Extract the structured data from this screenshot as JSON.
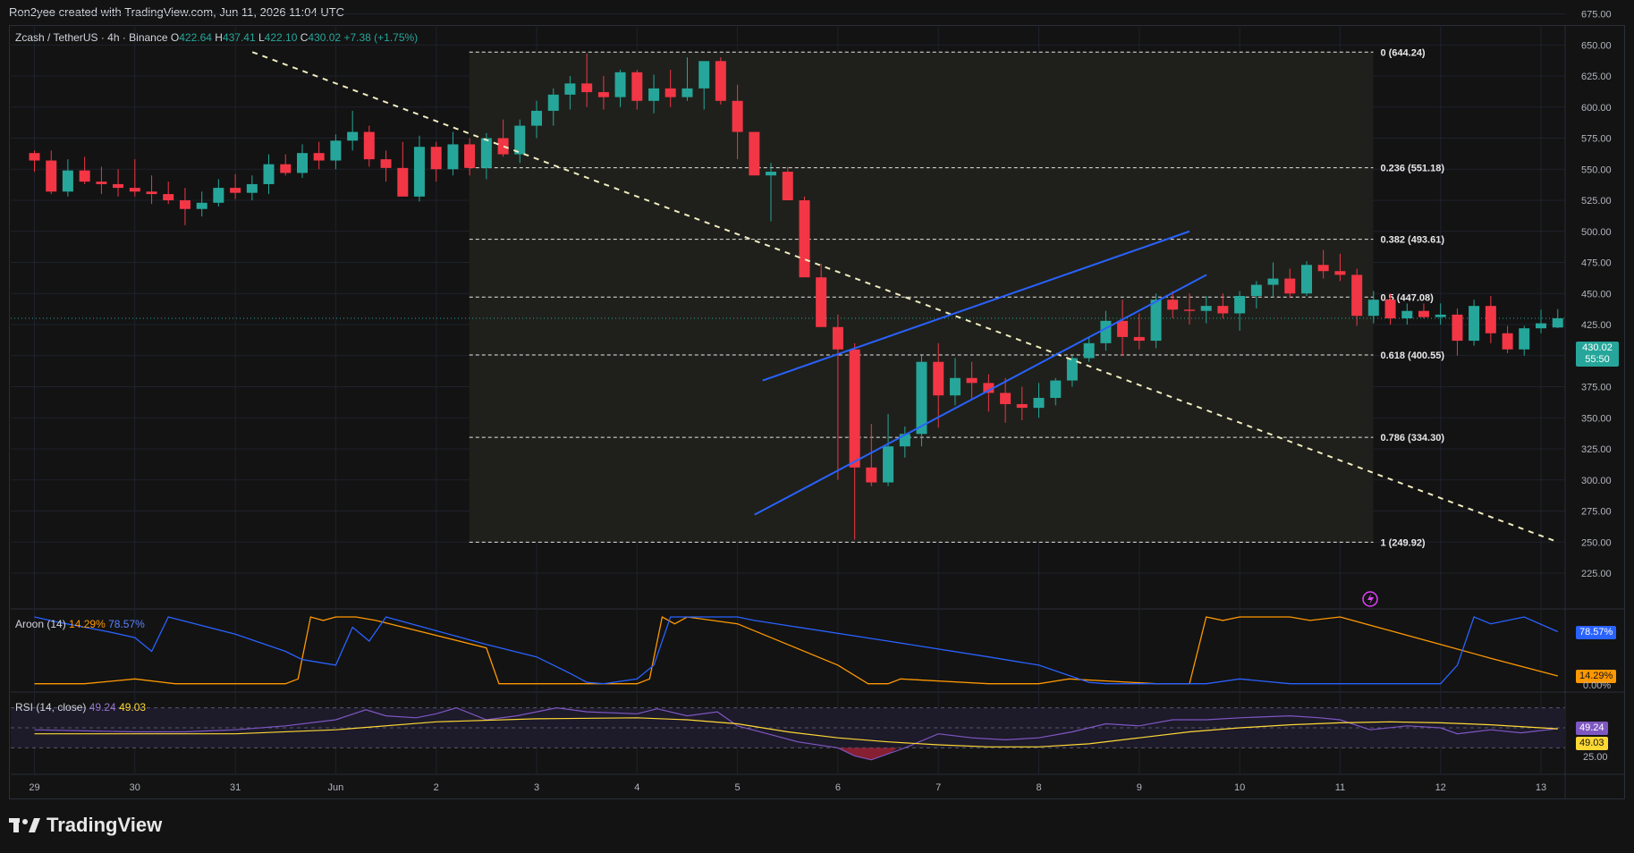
{
  "header": {
    "credit": "Ron2yee created with TradingView.com, Jun 11, 2026 11:04 UTC"
  },
  "symbol": {
    "name": "Zcash / TetherUS · 4h · Binance",
    "open_label": "O",
    "open": "422.64",
    "high_label": "H",
    "high": "437.41",
    "low_label": "L",
    "low": "422.10",
    "close_label": "C",
    "close": "430.02",
    "change": "+7.38 (+1.75%)"
  },
  "price_badge": {
    "price": "430.02",
    "countdown": "55:50"
  },
  "colors": {
    "up": "#26a69a",
    "down": "#f23645",
    "wedge": "#2962ff",
    "fib": "#e8e8e8",
    "aroon_up": "#ff9800",
    "aroon_down": "#2962ff",
    "rsi": "#7e57c2",
    "rsi_ma": "#fdd835"
  },
  "price_axis": {
    "ticks": [
      "225.00",
      "250.00",
      "275.00",
      "300.00",
      "325.00",
      "350.00",
      "375.00",
      "400.00",
      "425.00",
      "450.00",
      "475.00",
      "500.00",
      "525.00",
      "550.00",
      "575.00",
      "600.00",
      "625.00",
      "650.00",
      "675.00"
    ]
  },
  "time_axis": {
    "labels": [
      "29",
      "30",
      "31",
      "Jun",
      "2",
      "3",
      "4",
      "5",
      "6",
      "7",
      "8",
      "9",
      "10",
      "11",
      "12",
      "13"
    ]
  },
  "fib_levels": [
    {
      "label": "0 (644.24)",
      "price": 644.24
    },
    {
      "label": "0.236 (551.18)",
      "price": 551.18
    },
    {
      "label": "0.382 (493.61)",
      "price": 493.61
    },
    {
      "label": "0.5 (447.08)",
      "price": 447.08
    },
    {
      "label": "0.618 (400.55)",
      "price": 400.55
    },
    {
      "label": "0.786 (334.30)",
      "price": 334.3
    },
    {
      "label": "1 (249.92)",
      "price": 249.92
    }
  ],
  "aroon": {
    "title": "Aroon (14)",
    "up_value": "14.29%",
    "down_value": "78.57%",
    "axis_label": "0.00%"
  },
  "rsi": {
    "title": "RSI (14, close)",
    "value": "49.24",
    "ma_value": "49.03",
    "axis_label": "25.00"
  },
  "footer": {
    "brand": "TradingView"
  },
  "chart_data": {
    "type": "candlestick",
    "title": "Zcash / TetherUS · 4h · Binance",
    "x_unit": "days (0 = May 29 00:00 UTC)",
    "ylim": [
      215,
      685
    ],
    "candles": [
      [
        0.0,
        563,
        565,
        548,
        557
      ],
      [
        0.167,
        557,
        565,
        530,
        532
      ],
      [
        0.333,
        532,
        558,
        528,
        549
      ],
      [
        0.5,
        549,
        560,
        538,
        540
      ],
      [
        0.667,
        540,
        552,
        530,
        538
      ],
      [
        0.833,
        538,
        550,
        528,
        535
      ],
      [
        1.0,
        535,
        558,
        528,
        532
      ],
      [
        1.167,
        532,
        545,
        522,
        530
      ],
      [
        1.333,
        530,
        540,
        522,
        525
      ],
      [
        1.5,
        525,
        535,
        505,
        518
      ],
      [
        1.667,
        518,
        532,
        512,
        523
      ],
      [
        1.833,
        523,
        542,
        520,
        535
      ],
      [
        2.0,
        535,
        546,
        526,
        531
      ],
      [
        2.167,
        531,
        545,
        525,
        538
      ],
      [
        2.333,
        538,
        562,
        530,
        554
      ],
      [
        2.5,
        554,
        562,
        545,
        547
      ],
      [
        2.667,
        547,
        570,
        543,
        563
      ],
      [
        2.833,
        563,
        572,
        550,
        557
      ],
      [
        3.0,
        557,
        578,
        550,
        573
      ],
      [
        3.167,
        573,
        597,
        565,
        580
      ],
      [
        3.333,
        580,
        585,
        552,
        558
      ],
      [
        3.5,
        558,
        565,
        540,
        551
      ],
      [
        3.667,
        551,
        572,
        528,
        528
      ],
      [
        3.833,
        528,
        577,
        524,
        568
      ],
      [
        4.0,
        568,
        572,
        540,
        550
      ],
      [
        4.167,
        550,
        580,
        545,
        570
      ],
      [
        4.333,
        570,
        575,
        545,
        551
      ],
      [
        4.5,
        551,
        579,
        542,
        575
      ],
      [
        4.667,
        575,
        590,
        560,
        562
      ],
      [
        4.833,
        562,
        590,
        555,
        585
      ],
      [
        5.0,
        585,
        605,
        575,
        597
      ],
      [
        5.167,
        597,
        615,
        585,
        610
      ],
      [
        5.333,
        610,
        625,
        598,
        619
      ],
      [
        5.5,
        619,
        643,
        600,
        612
      ],
      [
        5.667,
        612,
        625,
        598,
        608
      ],
      [
        5.833,
        608,
        630,
        600,
        628
      ],
      [
        6.0,
        628,
        630,
        598,
        605
      ],
      [
        6.167,
        605,
        626,
        595,
        615
      ],
      [
        6.333,
        615,
        630,
        600,
        608
      ],
      [
        6.5,
        608,
        640,
        605,
        615
      ],
      [
        6.667,
        615,
        637,
        598,
        637
      ],
      [
        6.833,
        637,
        640,
        602,
        605
      ],
      [
        7.0,
        605,
        618,
        558,
        580
      ],
      [
        7.167,
        580,
        578,
        545,
        545
      ],
      [
        7.333,
        545,
        555,
        508,
        548
      ],
      [
        7.5,
        548,
        552,
        525,
        525
      ],
      [
        7.667,
        525,
        528,
        468,
        463
      ],
      [
        7.833,
        463,
        474,
        445,
        423
      ],
      [
        8.0,
        423,
        433,
        300,
        405
      ],
      [
        8.167,
        405,
        410,
        252,
        310
      ],
      [
        8.333,
        310,
        345,
        295,
        298
      ],
      [
        8.5,
        298,
        353,
        295,
        327
      ],
      [
        8.667,
        327,
        343,
        318,
        337
      ],
      [
        8.833,
        337,
        400,
        327,
        395
      ],
      [
        9.0,
        395,
        410,
        342,
        368
      ],
      [
        9.167,
        368,
        398,
        360,
        382
      ],
      [
        9.333,
        382,
        395,
        365,
        378
      ],
      [
        9.5,
        378,
        385,
        355,
        370
      ],
      [
        9.667,
        370,
        382,
        346,
        361
      ],
      [
        9.833,
        361,
        375,
        348,
        358
      ],
      [
        10.0,
        358,
        378,
        350,
        366
      ],
      [
        10.167,
        366,
        382,
        360,
        380
      ],
      [
        10.333,
        380,
        400,
        375,
        398
      ],
      [
        10.5,
        398,
        415,
        395,
        410
      ],
      [
        10.667,
        410,
        436,
        404,
        428
      ],
      [
        10.833,
        428,
        445,
        400,
        415
      ],
      [
        11.0,
        415,
        434,
        405,
        412
      ],
      [
        11.167,
        412,
        450,
        406,
        445
      ],
      [
        11.333,
        445,
        452,
        430,
        437
      ],
      [
        11.5,
        437,
        450,
        425,
        436
      ],
      [
        11.667,
        436,
        448,
        426,
        440
      ],
      [
        11.833,
        440,
        450,
        430,
        434
      ],
      [
        12.0,
        434,
        452,
        420,
        448
      ],
      [
        12.167,
        448,
        460,
        438,
        457
      ],
      [
        12.333,
        457,
        475,
        447,
        462
      ],
      [
        12.5,
        462,
        470,
        447,
        450
      ],
      [
        12.667,
        450,
        476,
        448,
        473
      ],
      [
        12.833,
        473,
        485,
        462,
        468
      ],
      [
        13.0,
        468,
        482,
        460,
        465
      ],
      [
        13.167,
        465,
        470,
        424,
        432
      ],
      [
        13.333,
        432,
        452,
        426,
        445
      ],
      [
        13.5,
        445,
        450,
        425,
        430
      ],
      [
        13.667,
        430,
        442,
        425,
        436
      ],
      [
        13.833,
        436,
        442,
        430,
        431
      ],
      [
        14.0,
        431,
        442,
        425,
        433
      ],
      [
        14.167,
        433,
        438,
        400,
        412
      ],
      [
        14.333,
        412,
        445,
        408,
        440
      ],
      [
        14.5,
        440,
        448,
        410,
        418
      ],
      [
        14.667,
        418,
        424,
        402,
        405
      ],
      [
        14.833,
        405,
        424,
        400,
        422
      ],
      [
        15.0,
        422,
        437,
        418,
        426
      ],
      [
        15.167,
        422.64,
        437.41,
        422.1,
        430.02
      ]
    ],
    "aroon_up": [
      [
        0,
        3
      ],
      [
        0.25,
        3
      ],
      [
        0.5,
        3
      ],
      [
        1.0,
        10
      ],
      [
        1.4,
        3
      ],
      [
        2.5,
        3
      ],
      [
        2.625,
        10
      ],
      [
        2.75,
        100
      ],
      [
        2.875,
        95
      ],
      [
        3.0,
        100
      ],
      [
        3.2,
        100
      ],
      [
        3.4,
        95
      ],
      [
        4.5,
        55
      ],
      [
        4.625,
        3
      ],
      [
        6.0,
        3
      ],
      [
        6.125,
        10
      ],
      [
        6.25,
        100
      ],
      [
        6.375,
        90
      ],
      [
        6.5,
        100
      ],
      [
        7.0,
        90
      ],
      [
        7.5,
        60
      ],
      [
        8.0,
        30
      ],
      [
        8.3,
        3
      ],
      [
        8.5,
        3
      ],
      [
        8.625,
        10
      ],
      [
        9.5,
        3
      ],
      [
        10.0,
        3
      ],
      [
        10.3,
        10
      ],
      [
        11.167,
        3
      ],
      [
        11.5,
        3
      ],
      [
        11.667,
        100
      ],
      [
        11.833,
        95
      ],
      [
        12.0,
        100
      ],
      [
        12.5,
        100
      ],
      [
        12.7,
        95
      ],
      [
        13.0,
        100
      ],
      [
        13.5,
        80
      ],
      [
        14.0,
        60
      ],
      [
        14.5,
        40
      ],
      [
        15.167,
        14.29
      ]
    ],
    "aroon_down": [
      [
        0,
        100
      ],
      [
        0.25,
        92
      ],
      [
        0.5,
        85
      ],
      [
        0.75,
        78
      ],
      [
        1.0,
        70
      ],
      [
        1.167,
        50
      ],
      [
        1.333,
        100
      ],
      [
        2.0,
        75
      ],
      [
        2.5,
        50
      ],
      [
        2.667,
        38
      ],
      [
        3.0,
        30
      ],
      [
        3.167,
        85
      ],
      [
        3.333,
        65
      ],
      [
        3.5,
        100
      ],
      [
        4.0,
        80
      ],
      [
        4.5,
        60
      ],
      [
        5.0,
        42
      ],
      [
        5.333,
        18
      ],
      [
        5.5,
        5
      ],
      [
        5.667,
        3
      ],
      [
        6.0,
        10
      ],
      [
        6.167,
        30
      ],
      [
        6.333,
        100
      ],
      [
        6.833,
        100
      ],
      [
        7.0,
        100
      ],
      [
        7.167,
        95
      ],
      [
        8.5,
        65
      ],
      [
        9.5,
        42
      ],
      [
        10.0,
        30
      ],
      [
        10.5,
        5
      ],
      [
        10.667,
        3
      ],
      [
        11.667,
        3
      ],
      [
        12.0,
        10
      ],
      [
        12.5,
        3
      ],
      [
        13.0,
        3
      ],
      [
        13.5,
        3
      ],
      [
        14.0,
        3
      ],
      [
        14.167,
        30
      ],
      [
        14.333,
        100
      ],
      [
        14.5,
        90
      ],
      [
        14.833,
        100
      ],
      [
        15.167,
        78.57
      ]
    ],
    "rsi": [
      [
        0,
        48
      ],
      [
        0.5,
        47
      ],
      [
        1.0,
        46
      ],
      [
        1.5,
        46
      ],
      [
        2.0,
        48
      ],
      [
        2.5,
        52
      ],
      [
        3.0,
        58
      ],
      [
        3.3,
        68
      ],
      [
        3.5,
        62
      ],
      [
        3.8,
        60
      ],
      [
        4.0,
        64
      ],
      [
        4.2,
        70
      ],
      [
        4.5,
        58
      ],
      [
        4.8,
        62
      ],
      [
        5.0,
        66
      ],
      [
        5.2,
        70
      ],
      [
        5.5,
        66
      ],
      [
        6.0,
        64
      ],
      [
        6.2,
        69
      ],
      [
        6.5,
        62
      ],
      [
        6.8,
        66
      ],
      [
        7.0,
        52
      ],
      [
        7.3,
        44
      ],
      [
        7.6,
        36
      ],
      [
        8.0,
        30
      ],
      [
        8.167,
        22
      ],
      [
        8.333,
        18
      ],
      [
        8.5,
        24
      ],
      [
        8.667,
        30
      ],
      [
        9.0,
        44
      ],
      [
        9.333,
        40
      ],
      [
        9.667,
        38
      ],
      [
        10.0,
        40
      ],
      [
        10.333,
        46
      ],
      [
        10.667,
        54
      ],
      [
        11.0,
        52
      ],
      [
        11.333,
        58
      ],
      [
        11.667,
        58
      ],
      [
        12.0,
        60
      ],
      [
        12.5,
        62
      ],
      [
        12.8,
        60
      ],
      [
        13.0,
        58
      ],
      [
        13.3,
        48
      ],
      [
        13.667,
        52
      ],
      [
        14.0,
        50
      ],
      [
        14.167,
        44
      ],
      [
        14.5,
        48
      ],
      [
        14.8,
        45
      ],
      [
        15.167,
        49.24
      ]
    ],
    "rsi_ma": [
      [
        0,
        44
      ],
      [
        1,
        44
      ],
      [
        2,
        44
      ],
      [
        3,
        48
      ],
      [
        4,
        56
      ],
      [
        5,
        59
      ],
      [
        6,
        60
      ],
      [
        6.5,
        58
      ],
      [
        7,
        54
      ],
      [
        7.5,
        46
      ],
      [
        8,
        40
      ],
      [
        8.5,
        36
      ],
      [
        9,
        33
      ],
      [
        9.5,
        31
      ],
      [
        10,
        31
      ],
      [
        10.5,
        34
      ],
      [
        11,
        40
      ],
      [
        11.5,
        46
      ],
      [
        12,
        50
      ],
      [
        12.5,
        53
      ],
      [
        13,
        55
      ],
      [
        13.5,
        56
      ],
      [
        14,
        55
      ],
      [
        14.5,
        53
      ],
      [
        15.167,
        49.03
      ]
    ],
    "drawings": {
      "trend_down": [
        [
          2.17,
          644.24
        ],
        [
          15.17,
          249.92
        ]
      ],
      "wedge_upper": [
        [
          7.25,
          380
        ],
        [
          11.5,
          500
        ]
      ],
      "wedge_lower": [
        [
          7.17,
          272
        ],
        [
          11.67,
          465
        ]
      ],
      "fib_box_x": [
        4.33,
        13.33
      ]
    }
  }
}
